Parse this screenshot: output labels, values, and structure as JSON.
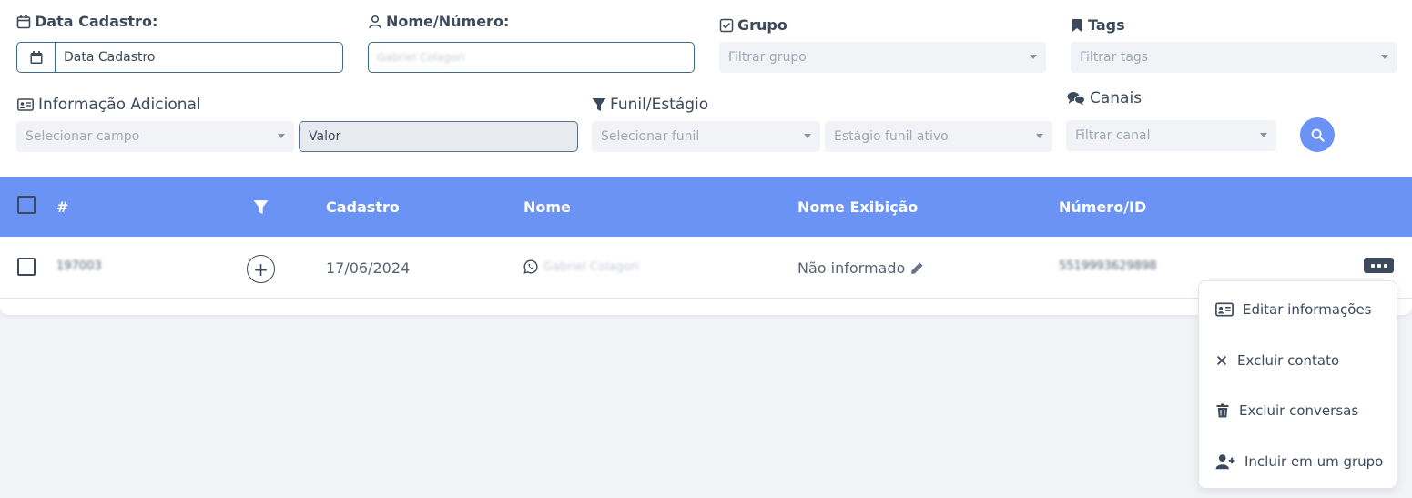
{
  "filters": {
    "data_cadastro": {
      "label": "Data Cadastro:",
      "placeholder": "Data Cadastro"
    },
    "nome_numero": {
      "label": "Nome/Número:",
      "value": "Gabriel Colagori"
    },
    "grupo": {
      "label": "Grupo",
      "placeholder": "Filtrar grupo"
    },
    "tags": {
      "label": "Tags",
      "placeholder": "Filtrar tags"
    },
    "info_adicional": {
      "label": "Informação Adicional",
      "field_placeholder": "Selecionar campo",
      "value_placeholder": "Valor"
    },
    "funil": {
      "label": "Funil/Estágio",
      "funil_placeholder": "Selecionar funil",
      "estagio_placeholder": "Estágio funil ativo"
    },
    "canais": {
      "label": "Canais",
      "placeholder": "Filtrar canal"
    }
  },
  "table": {
    "headers": {
      "id": "#",
      "cadastro": "Cadastro",
      "nome": "Nome",
      "nome_exibicao": "Nome Exibição",
      "numero": "Número/ID"
    },
    "rows": [
      {
        "id": "197003",
        "cadastro": "17/06/2024",
        "nome": "Gabriel Colagori",
        "nome_exibicao": "Não informado",
        "numero": "5519993629898"
      }
    ]
  },
  "menu": {
    "items": [
      {
        "label": "Editar informações",
        "icon": "id-card-icon"
      },
      {
        "label": "Excluir contato",
        "icon": "close-icon"
      },
      {
        "label": "Excluir conversas",
        "icon": "trash-icon"
      },
      {
        "label": "Incluir em um grupo",
        "icon": "user-plus-icon"
      }
    ]
  },
  "colors": {
    "accent": "#6b93f5",
    "text": "#3d4a5c",
    "background": "#f1f3f7"
  }
}
